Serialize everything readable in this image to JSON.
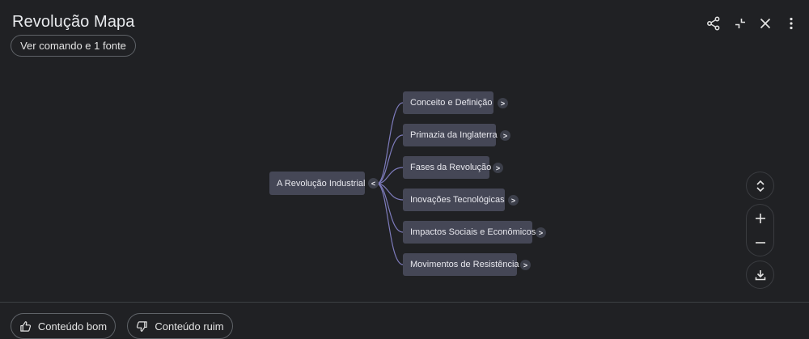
{
  "header": {
    "title": "Revolução Mapa",
    "command_button": "Ver comando e 1 fonte"
  },
  "toolbar_icons": [
    "share-icon",
    "collapse-icon",
    "close-icon",
    "more-vert-icon"
  ],
  "mindmap": {
    "root": {
      "label": "A Revolução Industrial",
      "toggle": "<"
    },
    "children": [
      {
        "label": "Conceito e Definição",
        "toggle": ">"
      },
      {
        "label": "Primazia da Inglaterra",
        "toggle": ">"
      },
      {
        "label": "Fases da Revolução",
        "toggle": ">"
      },
      {
        "label": "Inovações Tecnológicas",
        "toggle": ">"
      },
      {
        "label": "Impactos Sociais e Econômicos",
        "toggle": ">"
      },
      {
        "label": "Movimentos de Resistência",
        "toggle": ">"
      }
    ]
  },
  "controls": [
    "expand-collapse-icon",
    "zoom-in-icon",
    "zoom-out-icon",
    "download-icon"
  ],
  "footer": {
    "good_label": "Conteúdo bom",
    "bad_label": "Conteúdo ruim"
  },
  "colors": {
    "background": "#202124",
    "node": "#454756",
    "connector": "#8e8bd6"
  }
}
